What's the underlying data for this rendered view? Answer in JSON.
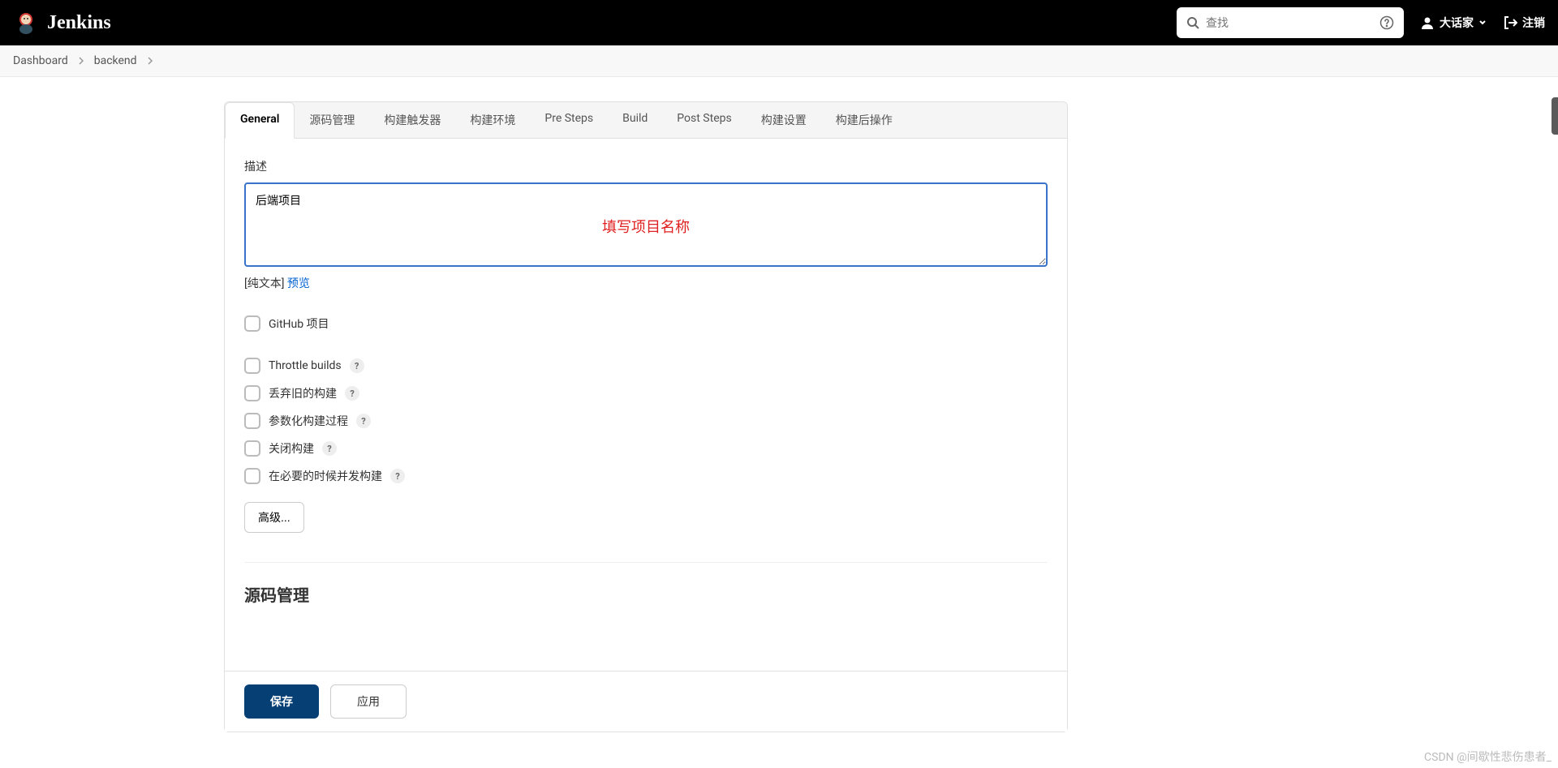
{
  "header": {
    "brand": "Jenkins",
    "search_placeholder": "查找",
    "username": "大话家",
    "logout": "注销"
  },
  "breadcrumb": {
    "items": [
      "Dashboard",
      "backend"
    ]
  },
  "tabs": [
    {
      "label": "General",
      "active": true
    },
    {
      "label": "源码管理",
      "active": false
    },
    {
      "label": "构建触发器",
      "active": false
    },
    {
      "label": "构建环境",
      "active": false
    },
    {
      "label": "Pre Steps",
      "active": false
    },
    {
      "label": "Build",
      "active": false
    },
    {
      "label": "Post Steps",
      "active": false
    },
    {
      "label": "构建设置",
      "active": false
    },
    {
      "label": "构建后操作",
      "active": false
    }
  ],
  "form": {
    "desc_label": "描述",
    "desc_value": "后端项目",
    "desc_overlay": "填写项目名称",
    "plain_text_label": "[纯文本]",
    "preview_link": "预览",
    "checkboxes": [
      {
        "label": "GitHub 项目",
        "help": false
      },
      {
        "label": "Throttle builds",
        "help": true
      },
      {
        "label": "丢弃旧的构建",
        "help": true
      },
      {
        "label": "参数化构建过程",
        "help": true
      },
      {
        "label": "关闭构建",
        "help": true
      },
      {
        "label": "在必要的时候并发构建",
        "help": true
      }
    ],
    "advanced_btn": "高级...",
    "section2_title": "源码管理"
  },
  "buttons": {
    "save": "保存",
    "apply": "应用"
  },
  "watermark": "CSDN @间歇性悲伤患者_"
}
